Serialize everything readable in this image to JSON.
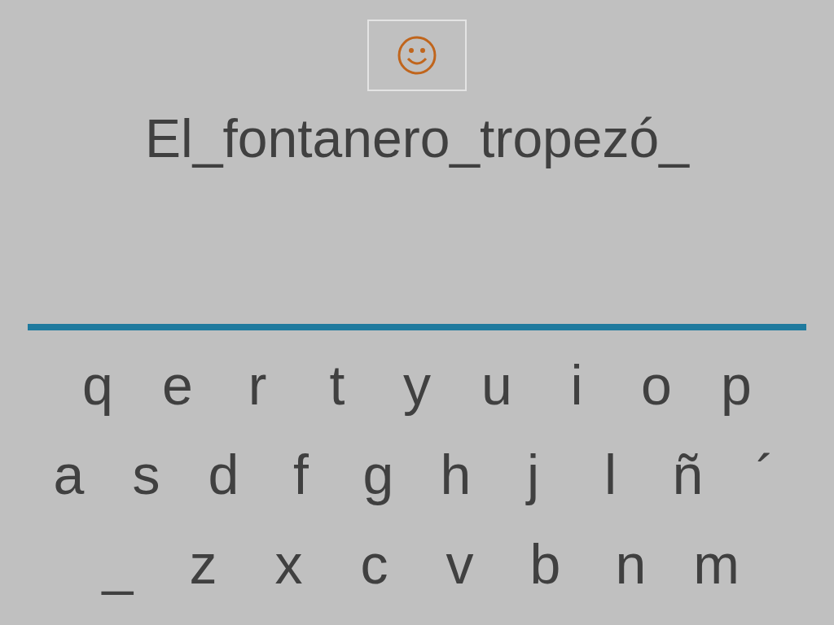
{
  "sentence": "El_fontanero_tropezó_",
  "keyboard": {
    "rows": [
      [
        "q",
        "e",
        "r",
        "t",
        "y",
        "u",
        "i",
        "o",
        "p"
      ],
      [
        "a",
        "s",
        "d",
        "f",
        "g",
        "h",
        "j",
        "l",
        "ñ",
        "´"
      ],
      [
        "_",
        "z",
        "x",
        "c",
        "v",
        "b",
        "n",
        "m"
      ]
    ]
  }
}
